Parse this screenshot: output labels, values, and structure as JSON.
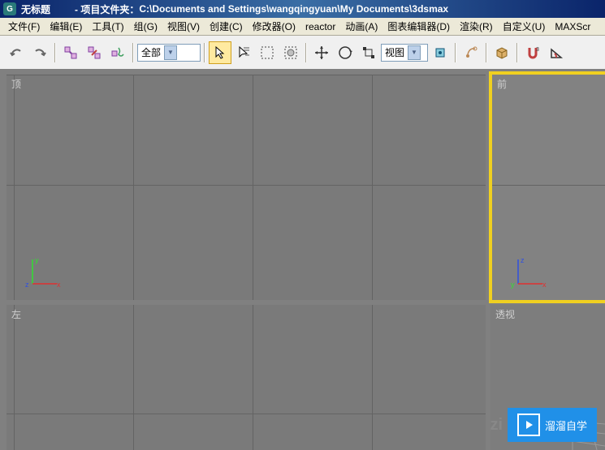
{
  "title": {
    "doc": "无标题",
    "project_prefix": "- 项目文件夹：",
    "project_path": "C:\\Documents and Settings\\wangqingyuan\\My Documents\\3dsmax"
  },
  "menu": {
    "file": "文件(F)",
    "edit": "编辑(E)",
    "tool": "工具(T)",
    "group": "组(G)",
    "view": "视图(V)",
    "create": "创建(C)",
    "modify": "修改器(O)",
    "reactor": "reactor",
    "anim": "动画(A)",
    "graph": "图表编辑器(D)",
    "render": "渲染(R)",
    "custom": "自定义(U)",
    "maxscr": "MAXScr"
  },
  "toolbar": {
    "filter": "全部",
    "view_selector": "视图"
  },
  "viewports": {
    "top": "顶",
    "front": "前",
    "left": "左",
    "persp": "透视"
  },
  "axis": {
    "x": "x",
    "y": "y",
    "z": "z"
  },
  "watermark": {
    "brand": "溜溜自学",
    "sub": "zi"
  }
}
